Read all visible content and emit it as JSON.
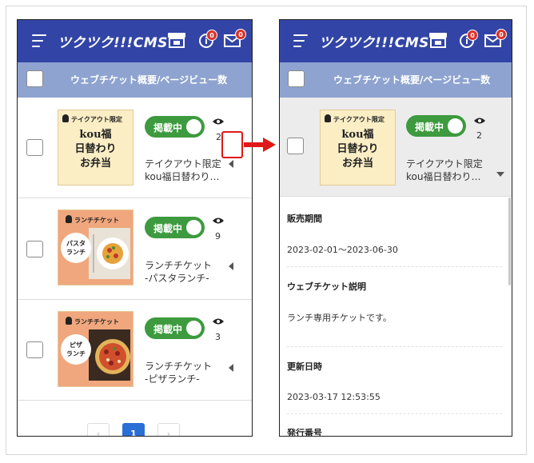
{
  "app": {
    "logo_text": "ツクツク!!!CMS",
    "info_badge": "0",
    "mail_badge": "0"
  },
  "list_header": {
    "title": "ウェブチケット概要/ページビュー数"
  },
  "tickets": [
    {
      "thumb_tag": "テイクアウト限定",
      "thumb_lines": [
        "kou福",
        "日替わり",
        "お弁当"
      ],
      "status": "掲載中",
      "views": "2",
      "name_line1": "テイクアウト限定",
      "name_line2": "kou福日替わり…"
    },
    {
      "thumb_tag": "ランチチケット",
      "thumb_circle": [
        "パスタ",
        "ランチ"
      ],
      "status": "掲載中",
      "views": "9",
      "name_line1": "ランチチケット",
      "name_line2": "-パスタランチ-"
    },
    {
      "thumb_tag": "ランチチケット",
      "thumb_circle": [
        "ピザ",
        "ランチ"
      ],
      "status": "掲載中",
      "views": "3",
      "name_line1": "ランチチケット",
      "name_line2": "-ピザランチ-"
    }
  ],
  "pagination": {
    "prev": "‹",
    "current": "1",
    "next": "›"
  },
  "detail": {
    "sales_period_label": "販売期間",
    "sales_period_value": "2023-02-01～2023-06-30",
    "description_label": "ウェブチケット説明",
    "description_value": "ランチ専用チケットです。",
    "updated_label": "更新日時",
    "updated_value": "2023-03-17 12:53:55",
    "issue_number_label": "発行番号"
  },
  "colors": {
    "header": "#3245a6",
    "subheader": "#8ea3cf",
    "toggle": "#3d9a3e",
    "badge": "#d9322c",
    "callout": "#e01818",
    "page_active": "#2a6fd6"
  }
}
